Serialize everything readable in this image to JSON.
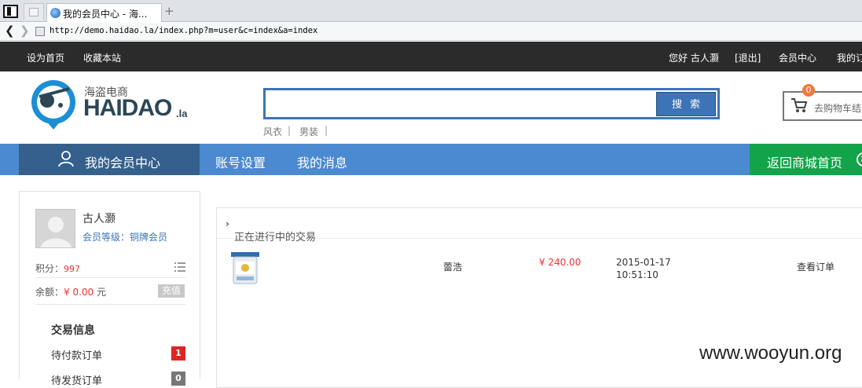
{
  "browser": {
    "tab_title": "我的会员中心 - 海...",
    "new_tab": "+",
    "back": "❮",
    "forward": "❯",
    "url": "http://demo.haidao.la/index.php?m=user&c=index&a=index"
  },
  "topbar": {
    "set_home": "设为首页",
    "bookmark": "收藏本站",
    "greeting": "您好 古人灏",
    "logout": "[退出]",
    "member_center": "会员中心",
    "my_orders": "我的订"
  },
  "logo": {
    "cn": "海盗电商",
    "en": "HAIDAO",
    "suffix": ".la"
  },
  "search": {
    "value": "",
    "button": "搜索",
    "hot": [
      "风衣",
      "男装"
    ],
    "sep": "|"
  },
  "cart": {
    "label": "去购物车结",
    "count": "0"
  },
  "nav": {
    "home": "我的会员中心",
    "items": [
      "账号设置",
      "我的消息"
    ],
    "back_to_mall": "返回商城首页",
    "back_icon": "✕"
  },
  "profile": {
    "name": "古人灏",
    "level_label": "会员等级：",
    "level": "铜牌会员",
    "points_label": "积分：",
    "points": "997",
    "balance_label": "余额：",
    "balance": "¥ 0.00",
    "balance_unit": "元",
    "recharge": "充值"
  },
  "trade": {
    "title": "交易信息",
    "items": [
      {
        "label": "待付款订单",
        "count": "1",
        "color": "#e02424"
      },
      {
        "label": "待发货订单",
        "count": "0",
        "color": "#777777"
      }
    ]
  },
  "orders": {
    "title": "正在进行中的交易",
    "rows": [
      {
        "product_icon": "milk-powder-can",
        "name": "蕾浩",
        "price": "¥ 240.00",
        "date": "2015-01-17",
        "time": "10:51:10",
        "action": "查看订单"
      }
    ]
  },
  "watermark": "www.wooyun.org",
  "colors": {
    "accent": "#4b8ad0",
    "nav_dark": "#35608d",
    "green": "#13a34a",
    "price_red": "#e33333"
  }
}
